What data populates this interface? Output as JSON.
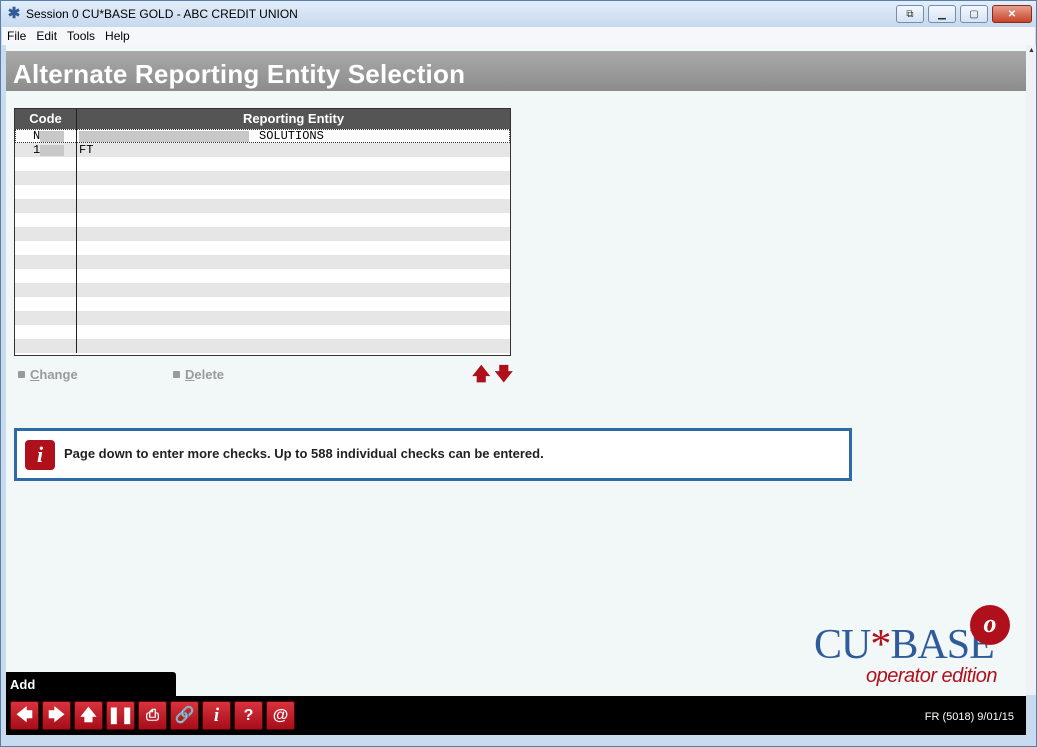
{
  "window": {
    "title": "Session 0 CU*BASE GOLD - ABC CREDIT UNION",
    "icon": "cubase-star-icon",
    "buttons": [
      "restore-icon",
      "minimize-icon",
      "maximize-icon",
      "close-icon"
    ],
    "close_label": "✕"
  },
  "menu": {
    "items": [
      "File",
      "Edit",
      "Tools",
      "Help"
    ]
  },
  "header": {
    "title": "Alternate Reporting Entity Selection"
  },
  "grid": {
    "columns": [
      "Code",
      "Reporting Entity"
    ],
    "rows": [
      {
        "code": "N",
        "entity": "SOLUTIONS",
        "selected": true
      },
      {
        "code": "1",
        "entity": "FT",
        "selected": false
      }
    ],
    "empty_rows": 14
  },
  "actions": {
    "change": {
      "first": "C",
      "rest": "hange"
    },
    "delete": {
      "first": "D",
      "rest": "elete"
    }
  },
  "scroll_arrows": {
    "up": "🡅",
    "down": "🡇"
  },
  "message": {
    "icon": "info-icon",
    "icon_glyph": "i",
    "text": "Page down to enter more checks. Up to 588 individual checks can be entered."
  },
  "logo": {
    "brand_left": "CU",
    "brand_star": "*",
    "brand_right": "BASE",
    "badge": "o",
    "edition": "operator edition"
  },
  "bottom": {
    "add_label": "Add",
    "status": "FR (5018) 9/01/15",
    "toolbar_buttons": [
      {
        "name": "back-arrow-icon",
        "glyph": "🡄"
      },
      {
        "name": "forward-arrow-icon",
        "glyph": "🡆"
      },
      {
        "name": "up-arrow-icon",
        "glyph": "🡅"
      },
      {
        "name": "pause-icon",
        "glyph": "❚❚"
      },
      {
        "name": "print-icon",
        "glyph": "⎙"
      },
      {
        "name": "link-icon",
        "glyph": "🔗"
      },
      {
        "name": "info-icon",
        "glyph": "i"
      },
      {
        "name": "help-icon",
        "glyph": "?"
      },
      {
        "name": "at-icon",
        "glyph": "@"
      }
    ]
  },
  "colors": {
    "accent_red": "#b0101c",
    "frame_blue": "#2e6aa6",
    "header_gray": "#999999"
  }
}
